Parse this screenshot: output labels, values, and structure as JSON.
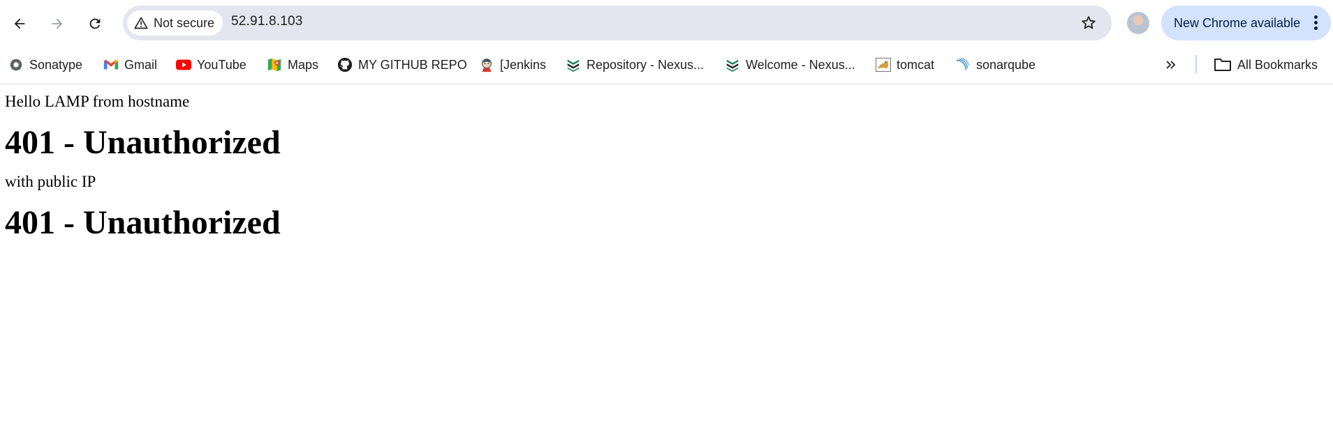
{
  "browser": {
    "security_label": "Not secure",
    "url": "52.91.8.103",
    "update_label": "New Chrome available"
  },
  "bookmarks": [
    {
      "label": "Sonatype",
      "icon": "sonatype-icon"
    },
    {
      "label": "Gmail",
      "icon": "gmail-icon"
    },
    {
      "label": "YouTube",
      "icon": "youtube-icon"
    },
    {
      "label": "Maps",
      "icon": "maps-icon"
    },
    {
      "label": "MY GITHUB REPO",
      "icon": "github-icon"
    },
    {
      "label": "[Jenkins",
      "icon": "jenkins-icon"
    },
    {
      "label": "Repository - Nexus...",
      "icon": "nexus-icon"
    },
    {
      "label": "Welcome - Nexus...",
      "icon": "nexus-icon"
    },
    {
      "label": "tomcat",
      "icon": "tomcat-icon"
    },
    {
      "label": "sonarqube",
      "icon": "sonarqube-icon"
    }
  ],
  "all_bookmarks_label": "All Bookmarks",
  "page": {
    "line1": "Hello LAMP from hostname",
    "heading1": "401 - Unauthorized",
    "line2": "with public IP",
    "heading2": "401 - Unauthorized"
  },
  "colors": {
    "omnibox_bg": "#e3e6ee",
    "update_pill_bg": "#d3e3fd",
    "youtube_red": "#ff0000"
  }
}
